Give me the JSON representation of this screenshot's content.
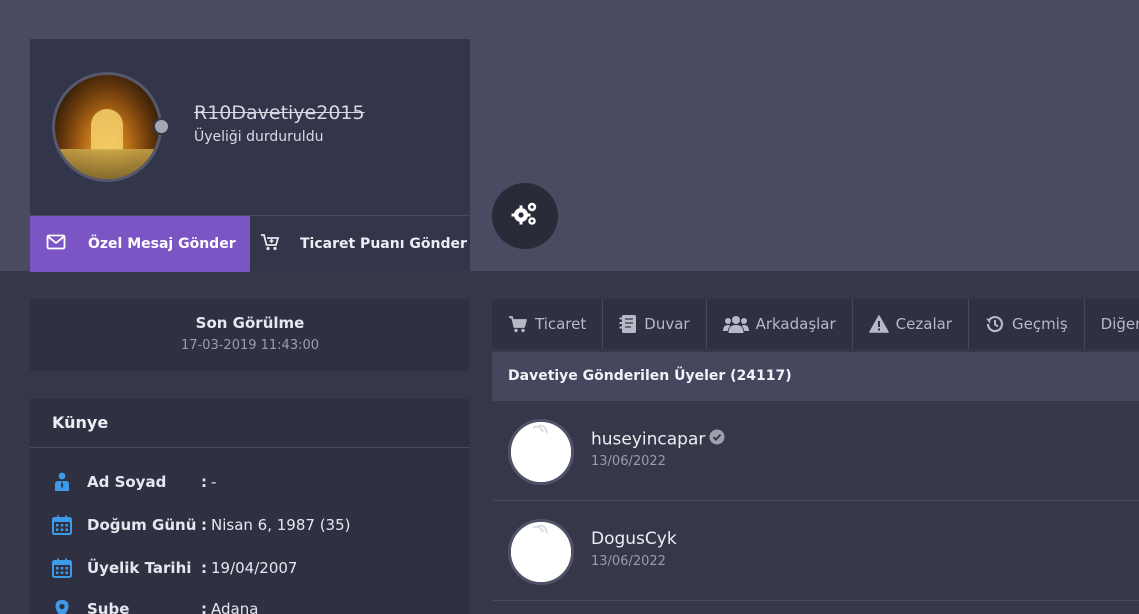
{
  "profile": {
    "username": "R10Davetiye2015",
    "status": "Üyeliği durduruldu"
  },
  "actions": {
    "message_label": "Özel Mesaj Gönder",
    "trade_label": "Ticaret Puanı Gönder"
  },
  "last_seen": {
    "title": "Son Görülme",
    "time": "17-03-2019 11:43:00"
  },
  "kunye": {
    "title": "Künye",
    "rows": [
      {
        "label": "Ad Soyad",
        "sep": ":",
        "value": "-"
      },
      {
        "label": "Doğum Günü",
        "sep": ":",
        "value": "Nisan 6, 1987 (35)"
      },
      {
        "label": "Üyelik Tarihi",
        "sep": ":",
        "value": "19/04/2007"
      },
      {
        "label": "Şube",
        "sep": ":",
        "value": "Adana"
      }
    ]
  },
  "tabs": [
    {
      "label": "Ticaret",
      "icon": "cart-icon"
    },
    {
      "label": "Duvar",
      "icon": "notebook-icon"
    },
    {
      "label": "Arkadaşlar",
      "icon": "users-icon"
    },
    {
      "label": "Cezalar",
      "icon": "warning-icon"
    },
    {
      "label": "Geçmiş",
      "icon": "history-icon"
    },
    {
      "label": "Diğer",
      "icon": ""
    }
  ],
  "invited": {
    "title": "Davetiye Gönderilen Üyeler (24117)",
    "members": [
      {
        "name": "huseyincapar",
        "date": "13/06/2022",
        "verified": true
      },
      {
        "name": "DogusCyk",
        "date": "13/06/2022",
        "verified": false
      }
    ]
  },
  "colors": {
    "accent": "#7c55c4",
    "icon_blue": "#3d9be9",
    "header_band": "#4a4b63",
    "panel": "#2f3142"
  }
}
